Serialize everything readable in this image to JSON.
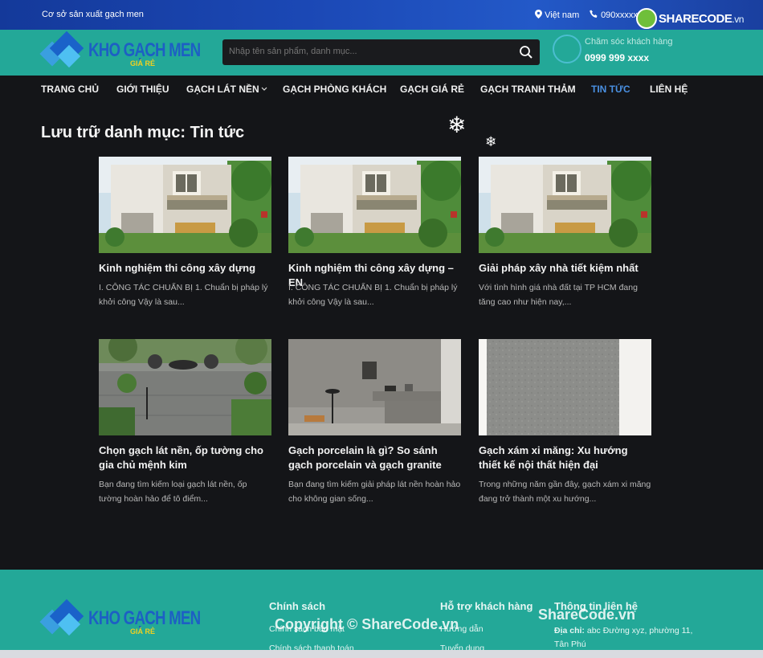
{
  "topbar": {
    "slogan": "Cơ sở sản xuất gạch men",
    "language": "Việt nam",
    "phone": "090xxxxx",
    "watermark_brand": "SHARECODE",
    "watermark_domain": ".vn"
  },
  "header": {
    "logo_text": "KHO GẠCH MEN",
    "logo_subtext": "GIÁ RẺ",
    "search_placeholder": "Nhập tên sản phẩm, danh mục...",
    "care_label": "Chăm sóc khách hàng",
    "care_phone": "0999 999 xxxx"
  },
  "nav": {
    "items": [
      {
        "label": "TRANG CHỦ",
        "active": false
      },
      {
        "label": "GIỚI THIỆU",
        "active": false
      },
      {
        "label": "GẠCH LÁT NỀN",
        "active": false,
        "has_dropdown": true
      },
      {
        "label": "GẠCH PHÒNG KHÁCH",
        "active": false
      },
      {
        "label": "GẠCH GIÁ RẺ",
        "active": false
      },
      {
        "label": "GẠCH TRANH THẢM",
        "active": false
      },
      {
        "label": "TIN TỨC",
        "active": true
      },
      {
        "label": "LIÊN HỆ",
        "active": false
      }
    ]
  },
  "page": {
    "title": "Lưu trữ danh mục: Tin tức"
  },
  "posts": [
    {
      "title": "Kinh nghiệm thi công xây dựng",
      "excerpt": "I. CÔNG TÁC CHUẨN BỊ 1. Chuẩn bị pháp lý khởi công Vậy là sau...",
      "image": "house-icon"
    },
    {
      "title": "Kinh nghiệm thi công xây dựng – EN",
      "excerpt": "I. CÔNG TÁC CHUẨN BỊ 1. Chuẩn bị pháp lý khởi công Vậy là sau...",
      "image": "house-icon"
    },
    {
      "title": "Giải pháp xây nhà tiết kiệm nhất",
      "excerpt": "Với tình hình giá nhà đất tại TP HCM đang tăng cao như hiện nay,...",
      "image": "house-icon"
    },
    {
      "title": "Chọn gạch lát nền, ốp tường cho gia chủ mệnh kim",
      "excerpt": "Bạn đang tìm kiếm loại gạch lát nền, ốp tường hoàn hảo để tô điểm...",
      "image": "patio-icon"
    },
    {
      "title": "Gạch porcelain là gì? So sánh gạch porcelain và gạch granite",
      "excerpt": "Bạn đang tìm kiếm giải pháp lát nền hoàn hảo cho không gian sống...",
      "image": "bathroom-icon"
    },
    {
      "title": "Gạch xám xi măng: Xu hướng thiết kế nội thất hiện đại",
      "excerpt": "Trong những năm gần đây, gạch xám xi măng đang trở thành một xu hướng...",
      "image": "tile-icon"
    }
  ],
  "footer": {
    "col1_title": "Chính sách",
    "col1_items": [
      "Chính sách bảo mật",
      "Chính sách thanh toán"
    ],
    "col2_title": "Hỗ trợ khách hàng",
    "col2_items": [
      "Hướng dẫn",
      "Tuyển dụng"
    ],
    "col3_title": "Thông tin liên hệ",
    "address_label": "Địa chỉ:",
    "address": "abc Đường xyz, phường 11, Tân Phú",
    "watermark_copyright": "Copyright © ShareCode.vn",
    "watermark_domain": "ShareCode.vn"
  },
  "colors": {
    "teal": "#23a898",
    "topbar_blue": "#1b48b5",
    "dark_bg": "#141518",
    "active_link": "#4a90e2"
  }
}
